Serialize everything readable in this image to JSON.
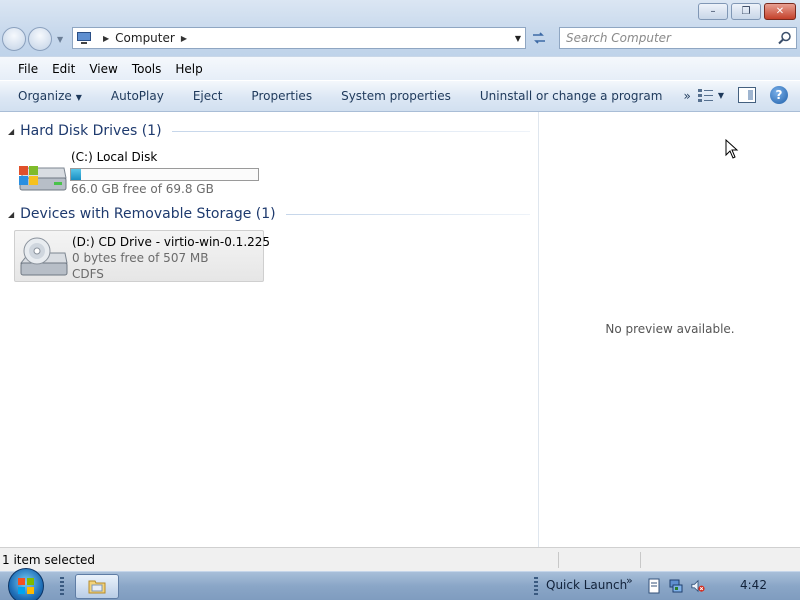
{
  "window": {
    "controls": {
      "minimize": "–",
      "restore": "❐",
      "close": "✕"
    }
  },
  "address_bar": {
    "crumb": "Computer",
    "refresh_icon": "refresh-icon"
  },
  "search": {
    "placeholder": "Search Computer"
  },
  "menu": [
    "File",
    "Edit",
    "View",
    "Tools",
    "Help"
  ],
  "command_bar": {
    "organize": "Organize",
    "autoplay": "AutoPlay",
    "eject": "Eject",
    "properties": "Properties",
    "system_properties": "System properties",
    "uninstall": "Uninstall or change a program",
    "more": "»"
  },
  "groups": [
    {
      "title": "Hard Disk Drives (1)",
      "drives": [
        {
          "name": "(C:) Local Disk",
          "free_text": "66.0 GB free of 69.8 GB",
          "used_fraction": 0.054
        }
      ]
    },
    {
      "title": "Devices with Removable Storage (1)",
      "drives": [
        {
          "name": "(D:) CD Drive - virtio-win-0.1.225",
          "free_text": "0 bytes free of 507 MB",
          "filesystem": "CDFS"
        }
      ]
    }
  ],
  "preview": {
    "message": "No preview available."
  },
  "status": {
    "text": "1 item selected"
  },
  "taskbar": {
    "quick_launch": "Quick Launch",
    "quick_launch_more": "»",
    "clock": "4:42"
  },
  "colors": {
    "accent": "#1e395b",
    "capacity_bar": "#26a0d2",
    "taskbar": "#8aa6c7"
  }
}
